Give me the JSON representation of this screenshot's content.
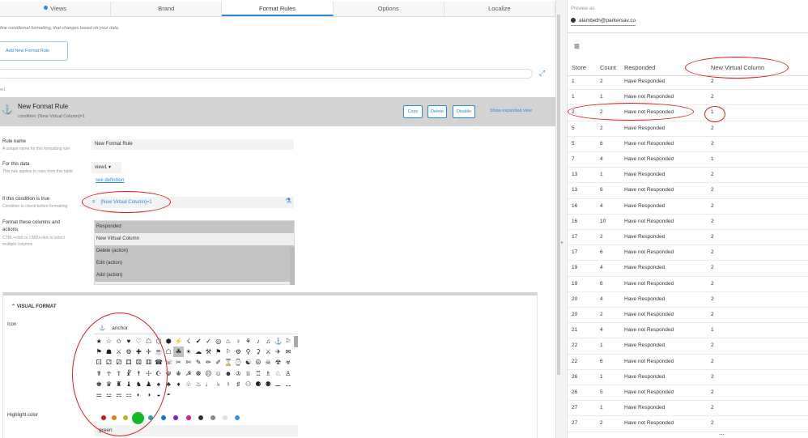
{
  "tabs": [
    {
      "label": "Views"
    },
    {
      "label": "Brand"
    },
    {
      "label": "Format Rules"
    },
    {
      "label": "Options"
    },
    {
      "label": "Localize"
    }
  ],
  "editor": {
    "description": "fine conditional formatting, that changes based on your data.",
    "add_rule_label": "Add New Format Rule",
    "section_label": "w1",
    "rule": {
      "title": "New Format Rule",
      "condition": "condition: [New Virtual Column]=1",
      "copy": "Copy",
      "delete": "Delete",
      "disable": "Disable",
      "expanded": "Show expanded view"
    },
    "fields": {
      "rule_name_label": "Rule name",
      "rule_name_sub": "A unique name for this formatting rule",
      "rule_name_value": "New Format Rule",
      "for_data_label": "For this data",
      "for_data_sub": "This rule applies to rows from this table",
      "for_data_value": "view1",
      "see_definition": "see definition",
      "condition_label": "If this condition is true",
      "condition_sub": "Condition to check before formatting",
      "condition_eq": "=",
      "condition_value": "[New Virtual Column]=1",
      "format_label_1": "Format these columns and",
      "format_label_2": "actions",
      "format_sub_1": "CTRL+click or CMD+click to select",
      "format_sub_2": "multiple columns",
      "columns": [
        {
          "label": "Responded",
          "selected": true
        },
        {
          "label": "New Virtual Column",
          "selected": false
        },
        {
          "label": "Delete (action)",
          "selected": true
        },
        {
          "label": "Edit (action)",
          "selected": true
        },
        {
          "label": "Add (action)",
          "selected": true
        }
      ]
    },
    "visual_format": {
      "title": "VISUAL FORMAT",
      "icon_label": "Icon",
      "icon_search": "anchor",
      "highlight_label": "Highlight color",
      "highlight_value": "green",
      "colors": [
        "#cc1a1a",
        "#e07f12",
        "#b8b515",
        "#14b824",
        "#13b2b2",
        "#1a6fd8",
        "#7c1fd8",
        "#d81a8c",
        "#333333",
        "#888888",
        "#e0e0e0",
        "#3d8fe0"
      ]
    }
  },
  "preview": {
    "preview_as_label": "Preview as",
    "user": "alambeth@parkersav.co",
    "columns": [
      "Store",
      "Count",
      "Responded",
      "New Virtual Column"
    ],
    "rows": [
      [
        "1",
        "2",
        "Have Responded",
        "2"
      ],
      [
        "1",
        "1",
        "Have not Responded",
        "2"
      ],
      [
        "2",
        "2",
        "Have not Responded",
        "1"
      ],
      [
        "5",
        "2",
        "Have Responded",
        "2"
      ],
      [
        "5",
        "6",
        "Have not Responded",
        "2"
      ],
      [
        "7",
        "4",
        "Have not Responded",
        "1"
      ],
      [
        "13",
        "1",
        "Have Responded",
        "2"
      ],
      [
        "13",
        "6",
        "Have not Responded",
        "2"
      ],
      [
        "16",
        "4",
        "Have Responded",
        "2"
      ],
      [
        "16",
        "10",
        "Have not Responded",
        "2"
      ],
      [
        "17",
        "2",
        "Have Responded",
        "2"
      ],
      [
        "17",
        "6",
        "Have not Responded",
        "2"
      ],
      [
        "19",
        "4",
        "Have Responded",
        "2"
      ],
      [
        "19",
        "6",
        "Have not Responded",
        "2"
      ],
      [
        "20",
        "4",
        "Have Responded",
        "2"
      ],
      [
        "20",
        "2",
        "Have not Responded",
        "2"
      ],
      [
        "21",
        "4",
        "Have not Responded",
        "1"
      ],
      [
        "22",
        "1",
        "Have Responded",
        "2"
      ],
      [
        "22",
        "6",
        "Have not Responded",
        "2"
      ],
      [
        "26",
        "1",
        "Have Responded",
        "2"
      ],
      [
        "26",
        "5",
        "Have not Responded",
        "2"
      ],
      [
        "27",
        "1",
        "Have Responded",
        "2"
      ],
      [
        "27",
        "2",
        "Have not Responded",
        "2"
      ]
    ]
  }
}
